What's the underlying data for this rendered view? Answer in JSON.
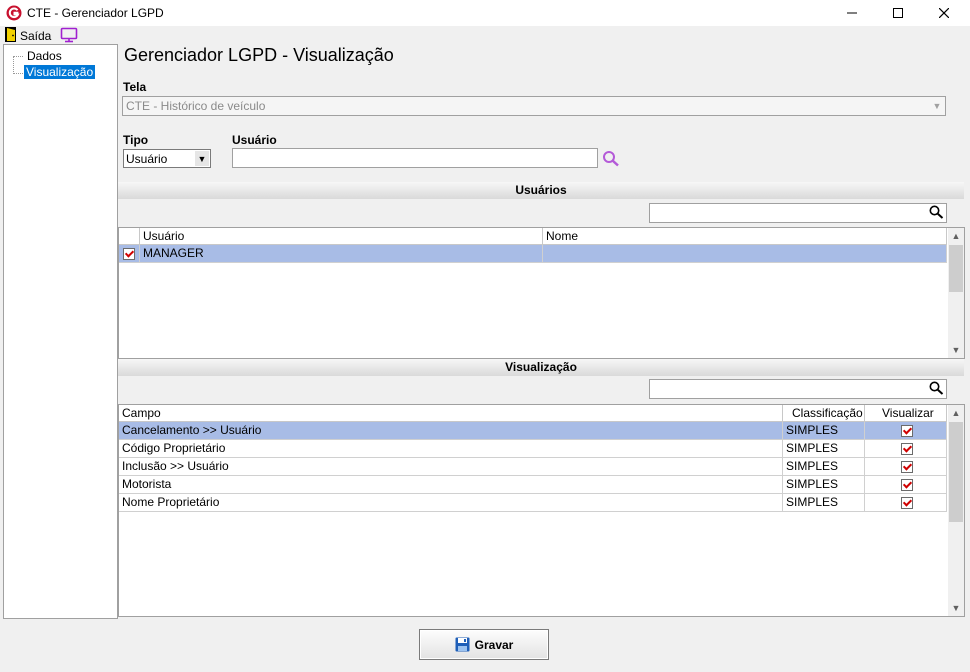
{
  "window": {
    "title": "CTE - Gerenciador LGPD"
  },
  "menu": {
    "saida_label": "Saída"
  },
  "tree": {
    "items": [
      {
        "label": "Dados"
      },
      {
        "label": "Visualização"
      }
    ]
  },
  "page": {
    "title": "Gerenciador LGPD - Visualização"
  },
  "form": {
    "tela_label": "Tela",
    "tela_value": "CTE - Histórico de veículo",
    "tipo_label": "Tipo",
    "tipo_value": "Usuário",
    "usuario_label": "Usuário",
    "usuario_value": ""
  },
  "usuarios": {
    "header": "Usuários",
    "search_value": "",
    "columns": [
      "Usuário",
      "Nome"
    ],
    "rows": [
      {
        "checked": true,
        "usuario": "MANAGER",
        "nome": ""
      }
    ]
  },
  "visualizacao": {
    "header": "Visualização",
    "search_value": "",
    "columns": [
      "Campo",
      "Classificação",
      "Visualizar"
    ],
    "rows": [
      {
        "campo": "Cancelamento >> Usuário",
        "classificacao": "SIMPLES",
        "visualizar": true
      },
      {
        "campo": "Código Proprietário",
        "classificacao": "SIMPLES",
        "visualizar": true
      },
      {
        "campo": "Inclusão >> Usuário",
        "classificacao": "SIMPLES",
        "visualizar": true
      },
      {
        "campo": "Motorista",
        "classificacao": "SIMPLES",
        "visualizar": true
      },
      {
        "campo": "Nome Proprietário",
        "classificacao": "SIMPLES",
        "visualizar": true
      }
    ]
  },
  "footer": {
    "gravar_label": "Gravar"
  },
  "colors": {
    "selection": "#a8bce6",
    "tree_selection": "#0078d7",
    "brand_red": "#c8102e",
    "check_red": "#d00000",
    "monitor_purple": "#a020d0"
  }
}
